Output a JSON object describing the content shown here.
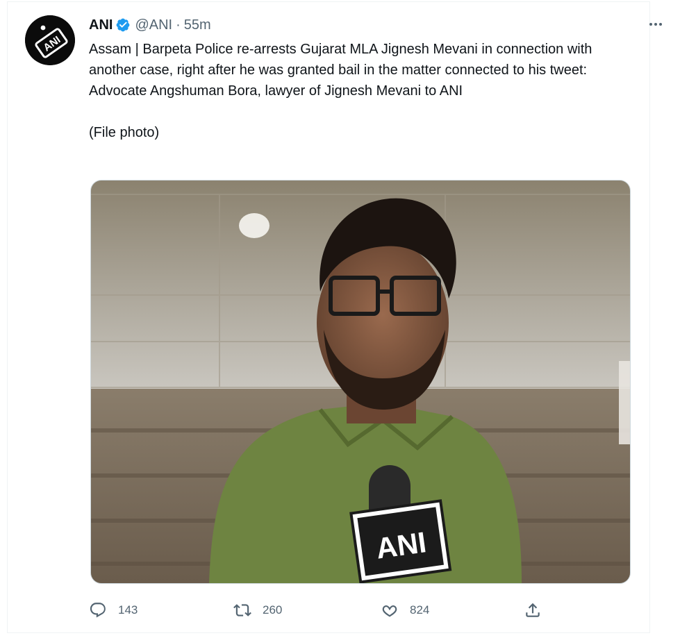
{
  "tweet": {
    "author_name": "ANI",
    "handle": "@ANI",
    "separator": "·",
    "time": "55m",
    "text": "Assam | Barpeta Police re-arrests Gujarat MLA Jignesh Mevani in connection with another case, right after he was granted bail in the matter connected to his tweet: Advocate Angshuman Bora, lawyer of Jignesh Mevani to ANI\n\n(File photo)",
    "avatar_logo_text": "ANI",
    "media": {
      "mic_flag_text": "ANI"
    },
    "stats": {
      "replies": "143",
      "retweets": "260",
      "likes": "824"
    }
  },
  "icons": {
    "more": "more-horizontal-icon",
    "verified": "verified-badge-icon",
    "reply": "reply-icon",
    "retweet": "retweet-icon",
    "like": "heart-icon",
    "share": "share-icon"
  },
  "colors": {
    "verified_blue": "#1d9bf0",
    "muted_text": "#536471",
    "main_text": "#0f1419"
  }
}
